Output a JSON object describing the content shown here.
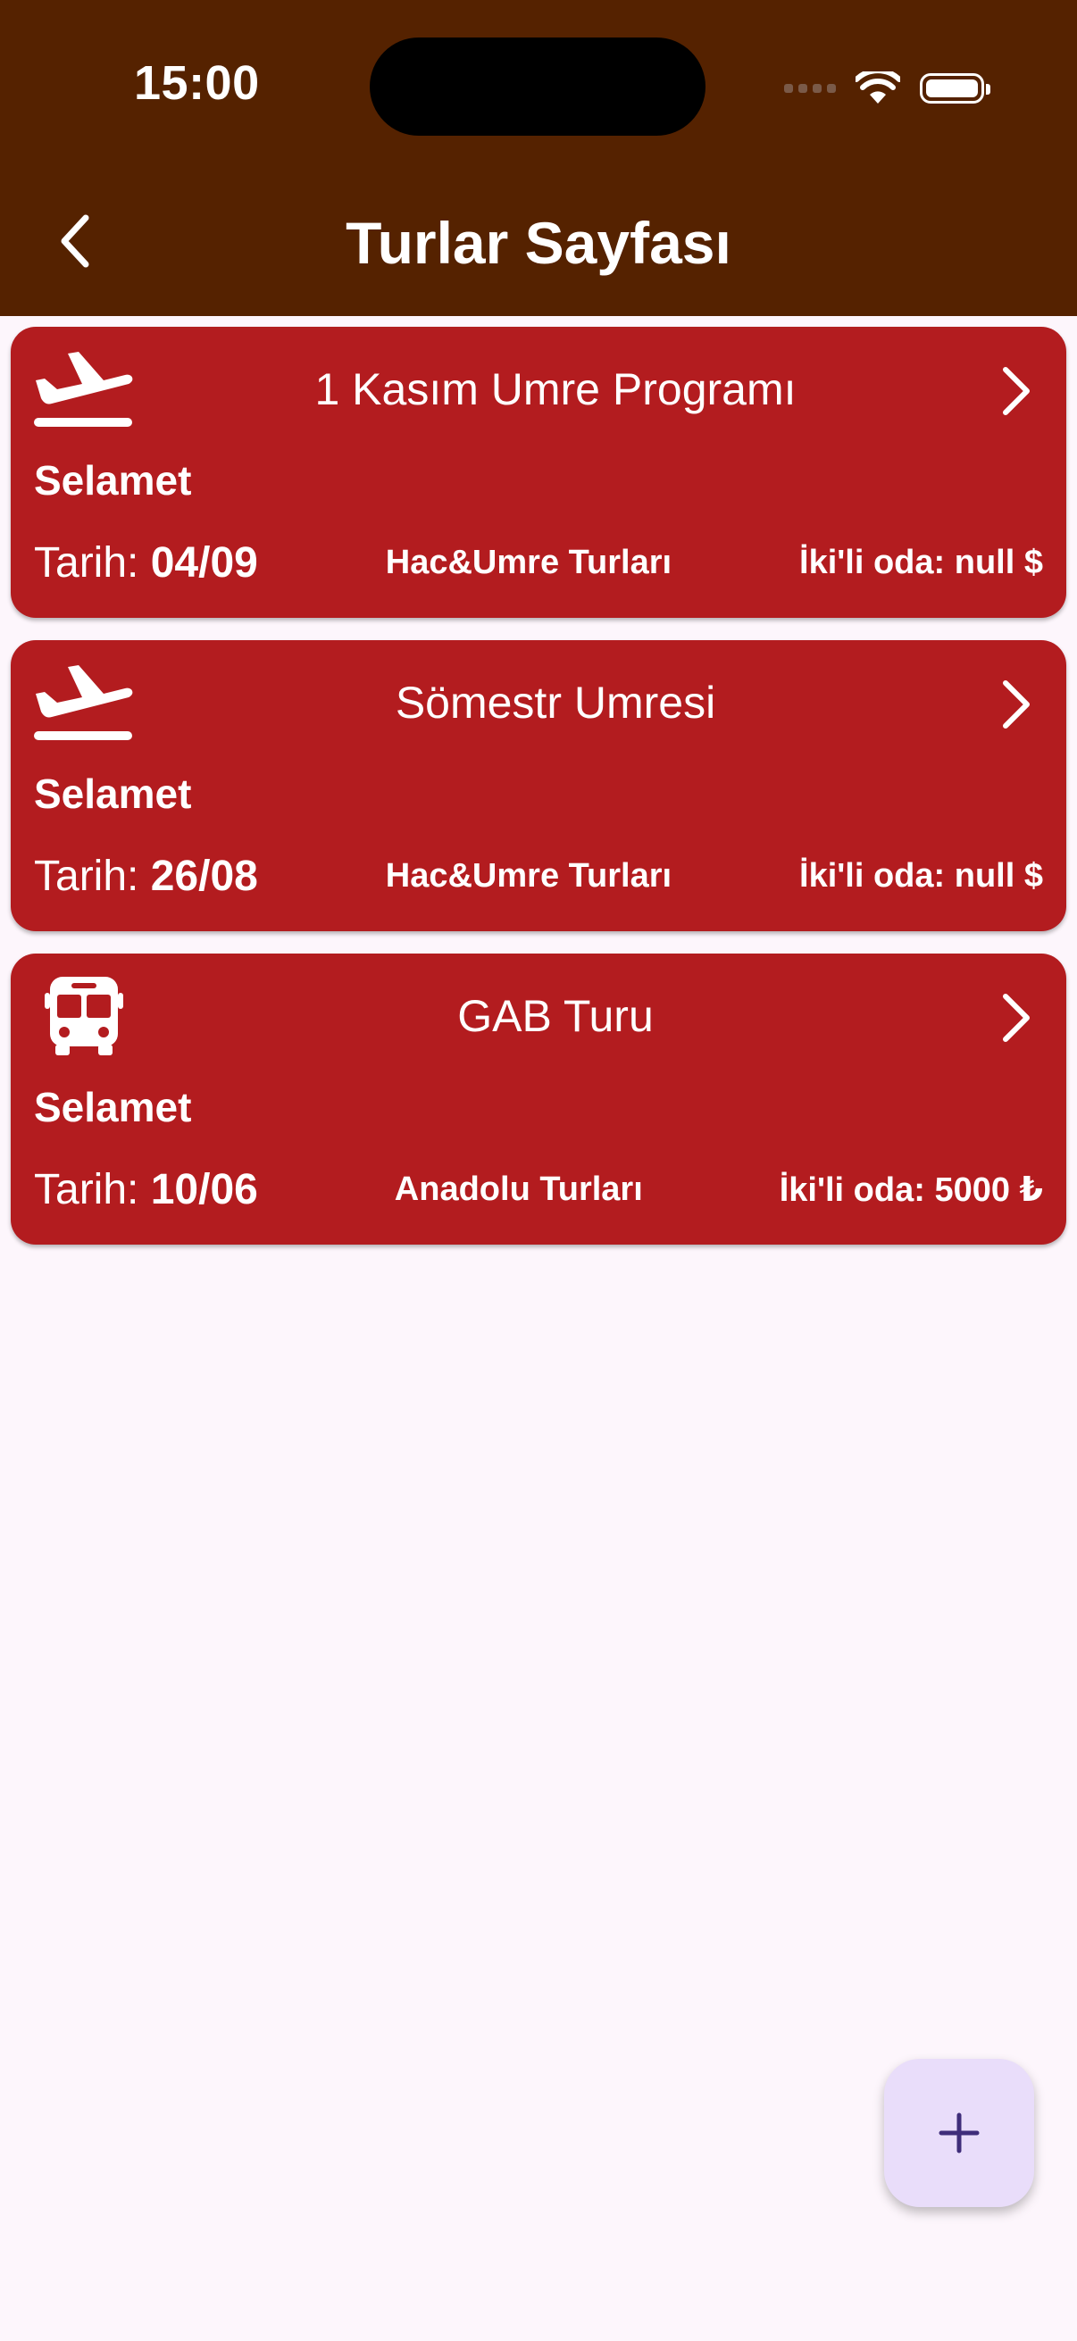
{
  "status_bar": {
    "time": "15:00"
  },
  "header": {
    "title": "Turlar Sayfası",
    "back_icon": "chevron-left-icon"
  },
  "colors": {
    "appbar": "#552200",
    "card": "#b31c1f",
    "background": "#fdf6fc",
    "fab_background": "#e9ddfa",
    "fab_icon": "#3f2d7a"
  },
  "tours": [
    {
      "icon": "plane-departure-icon",
      "title": "1 Kasım Umre Programı",
      "company": "Selamet",
      "date_label": "Tarih:",
      "date": "04/09",
      "category": "Hac&Umre Turları",
      "price": "İki'li oda: null $"
    },
    {
      "icon": "plane-departure-icon",
      "title": "Sömestr Umresi",
      "company": "Selamet",
      "date_label": "Tarih:",
      "date": "26/08",
      "category": "Hac&Umre Turları",
      "price": "İki'li oda: null $"
    },
    {
      "icon": "bus-icon",
      "title": "GAB Turu",
      "company": "Selamet",
      "date_label": "Tarih:",
      "date": "10/06",
      "category": "Anadolu Turları",
      "price": "İki'li oda: 5000 ₺"
    }
  ],
  "fab": {
    "icon": "plus-icon"
  }
}
